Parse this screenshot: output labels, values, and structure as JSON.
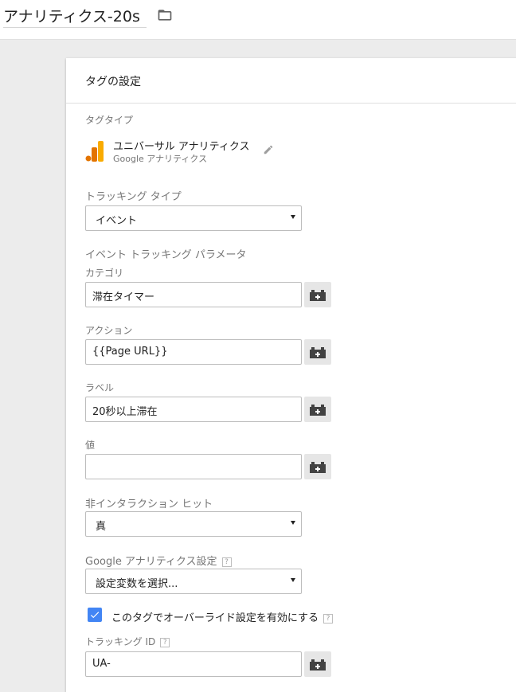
{
  "header": {
    "tag_name": "アナリティクス-20s",
    "folder_icon": "folder-icon"
  },
  "card": {
    "title": "タグの設定",
    "tag_type": {
      "label": "タグタイプ",
      "name": "ユニバーサル アナリティクス",
      "subtitle": "Google アナリティクス",
      "icon": "google-analytics-logo",
      "edit_icon": "pencil-icon"
    },
    "tracking_type": {
      "label": "トラッキング タイプ",
      "value": "イベント"
    },
    "event_params": {
      "section_label": "イベント トラッキング パラメータ",
      "category": {
        "label": "カテゴリ",
        "value": "滞在タイマー"
      },
      "action": {
        "label": "アクション",
        "value": "{{Page URL}}"
      },
      "label_field": {
        "label": "ラベル",
        "value": "20秒以上滞在"
      },
      "value_field": {
        "label": "値",
        "value": ""
      }
    },
    "non_interaction": {
      "label": "非インタラクション ヒット",
      "value": "真"
    },
    "ga_settings": {
      "label": "Google アナリティクス設定",
      "help": "?",
      "value": "設定変数を選択..."
    },
    "override": {
      "label": "このタグでオーバーライド設定を有効にする",
      "help": "?",
      "checked": true
    },
    "tracking_id": {
      "label": "トラッキング ID",
      "help": "?",
      "value": "UA-"
    },
    "variable_icon": "variable-picker-icon"
  },
  "colors": {
    "accent": "#4285f4",
    "ga_orange": "#f9ab00",
    "ga_yellow": "#fbbc04",
    "ga_dark_orange": "#e37400"
  }
}
